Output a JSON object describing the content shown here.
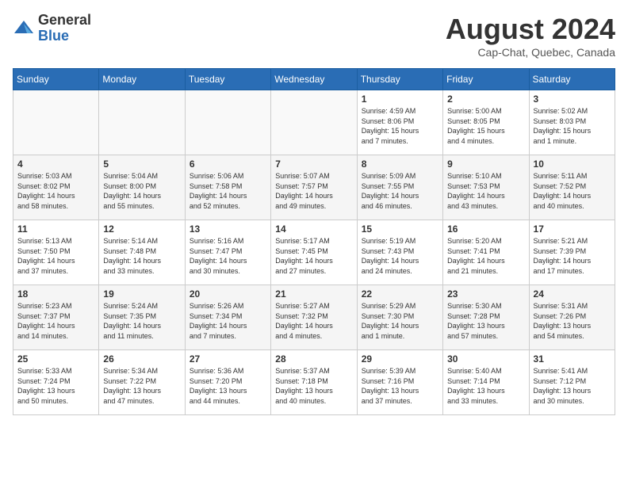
{
  "header": {
    "logo_general": "General",
    "logo_blue": "Blue",
    "month": "August 2024",
    "location": "Cap-Chat, Quebec, Canada"
  },
  "weekdays": [
    "Sunday",
    "Monday",
    "Tuesday",
    "Wednesday",
    "Thursday",
    "Friday",
    "Saturday"
  ],
  "weeks": [
    [
      {
        "day": "",
        "info": ""
      },
      {
        "day": "",
        "info": ""
      },
      {
        "day": "",
        "info": ""
      },
      {
        "day": "",
        "info": ""
      },
      {
        "day": "1",
        "info": "Sunrise: 4:59 AM\nSunset: 8:06 PM\nDaylight: 15 hours\nand 7 minutes."
      },
      {
        "day": "2",
        "info": "Sunrise: 5:00 AM\nSunset: 8:05 PM\nDaylight: 15 hours\nand 4 minutes."
      },
      {
        "day": "3",
        "info": "Sunrise: 5:02 AM\nSunset: 8:03 PM\nDaylight: 15 hours\nand 1 minute."
      }
    ],
    [
      {
        "day": "4",
        "info": "Sunrise: 5:03 AM\nSunset: 8:02 PM\nDaylight: 14 hours\nand 58 minutes."
      },
      {
        "day": "5",
        "info": "Sunrise: 5:04 AM\nSunset: 8:00 PM\nDaylight: 14 hours\nand 55 minutes."
      },
      {
        "day": "6",
        "info": "Sunrise: 5:06 AM\nSunset: 7:58 PM\nDaylight: 14 hours\nand 52 minutes."
      },
      {
        "day": "7",
        "info": "Sunrise: 5:07 AM\nSunset: 7:57 PM\nDaylight: 14 hours\nand 49 minutes."
      },
      {
        "day": "8",
        "info": "Sunrise: 5:09 AM\nSunset: 7:55 PM\nDaylight: 14 hours\nand 46 minutes."
      },
      {
        "day": "9",
        "info": "Sunrise: 5:10 AM\nSunset: 7:53 PM\nDaylight: 14 hours\nand 43 minutes."
      },
      {
        "day": "10",
        "info": "Sunrise: 5:11 AM\nSunset: 7:52 PM\nDaylight: 14 hours\nand 40 minutes."
      }
    ],
    [
      {
        "day": "11",
        "info": "Sunrise: 5:13 AM\nSunset: 7:50 PM\nDaylight: 14 hours\nand 37 minutes."
      },
      {
        "day": "12",
        "info": "Sunrise: 5:14 AM\nSunset: 7:48 PM\nDaylight: 14 hours\nand 33 minutes."
      },
      {
        "day": "13",
        "info": "Sunrise: 5:16 AM\nSunset: 7:47 PM\nDaylight: 14 hours\nand 30 minutes."
      },
      {
        "day": "14",
        "info": "Sunrise: 5:17 AM\nSunset: 7:45 PM\nDaylight: 14 hours\nand 27 minutes."
      },
      {
        "day": "15",
        "info": "Sunrise: 5:19 AM\nSunset: 7:43 PM\nDaylight: 14 hours\nand 24 minutes."
      },
      {
        "day": "16",
        "info": "Sunrise: 5:20 AM\nSunset: 7:41 PM\nDaylight: 14 hours\nand 21 minutes."
      },
      {
        "day": "17",
        "info": "Sunrise: 5:21 AM\nSunset: 7:39 PM\nDaylight: 14 hours\nand 17 minutes."
      }
    ],
    [
      {
        "day": "18",
        "info": "Sunrise: 5:23 AM\nSunset: 7:37 PM\nDaylight: 14 hours\nand 14 minutes."
      },
      {
        "day": "19",
        "info": "Sunrise: 5:24 AM\nSunset: 7:35 PM\nDaylight: 14 hours\nand 11 minutes."
      },
      {
        "day": "20",
        "info": "Sunrise: 5:26 AM\nSunset: 7:34 PM\nDaylight: 14 hours\nand 7 minutes."
      },
      {
        "day": "21",
        "info": "Sunrise: 5:27 AM\nSunset: 7:32 PM\nDaylight: 14 hours\nand 4 minutes."
      },
      {
        "day": "22",
        "info": "Sunrise: 5:29 AM\nSunset: 7:30 PM\nDaylight: 14 hours\nand 1 minute."
      },
      {
        "day": "23",
        "info": "Sunrise: 5:30 AM\nSunset: 7:28 PM\nDaylight: 13 hours\nand 57 minutes."
      },
      {
        "day": "24",
        "info": "Sunrise: 5:31 AM\nSunset: 7:26 PM\nDaylight: 13 hours\nand 54 minutes."
      }
    ],
    [
      {
        "day": "25",
        "info": "Sunrise: 5:33 AM\nSunset: 7:24 PM\nDaylight: 13 hours\nand 50 minutes."
      },
      {
        "day": "26",
        "info": "Sunrise: 5:34 AM\nSunset: 7:22 PM\nDaylight: 13 hours\nand 47 minutes."
      },
      {
        "day": "27",
        "info": "Sunrise: 5:36 AM\nSunset: 7:20 PM\nDaylight: 13 hours\nand 44 minutes."
      },
      {
        "day": "28",
        "info": "Sunrise: 5:37 AM\nSunset: 7:18 PM\nDaylight: 13 hours\nand 40 minutes."
      },
      {
        "day": "29",
        "info": "Sunrise: 5:39 AM\nSunset: 7:16 PM\nDaylight: 13 hours\nand 37 minutes."
      },
      {
        "day": "30",
        "info": "Sunrise: 5:40 AM\nSunset: 7:14 PM\nDaylight: 13 hours\nand 33 minutes."
      },
      {
        "day": "31",
        "info": "Sunrise: 5:41 AM\nSunset: 7:12 PM\nDaylight: 13 hours\nand 30 minutes."
      }
    ]
  ]
}
